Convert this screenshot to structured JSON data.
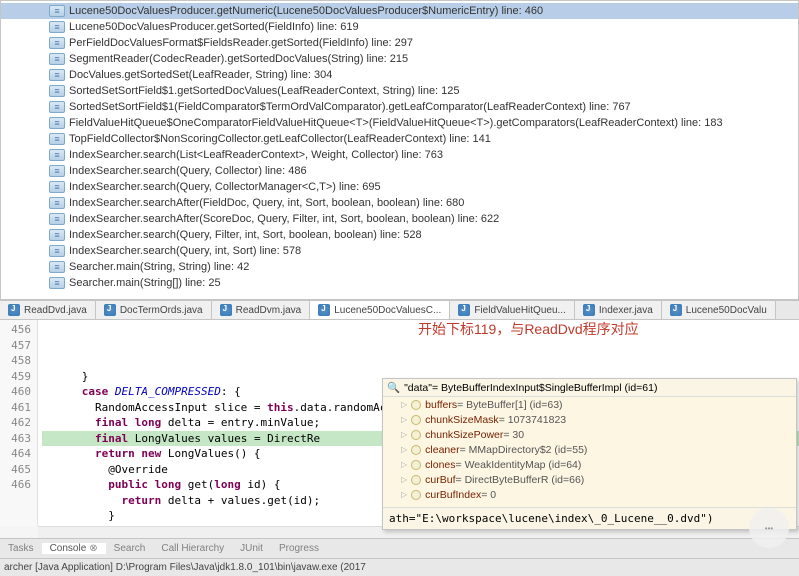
{
  "stack": [
    "Lucene50DocValuesProducer.getNumeric(Lucene50DocValuesProducer$NumericEntry) line: 460",
    "Lucene50DocValuesProducer.getSorted(FieldInfo) line: 619",
    "PerFieldDocValuesFormat$FieldsReader.getSorted(FieldInfo) line: 297",
    "SegmentReader(CodecReader).getSortedDocValues(String) line: 215",
    "DocValues.getSortedSet(LeafReader, String) line: 304",
    "SortedSetSortField$1.getSortedDocValues(LeafReaderContext, String) line: 125",
    "SortedSetSortField$1(FieldComparator$TermOrdValComparator).getLeafComparator(LeafReaderContext) line: 767",
    "FieldValueHitQueue$OneComparatorFieldValueHitQueue<T>(FieldValueHitQueue<T>).getComparators(LeafReaderContext) line: 183",
    "TopFieldCollector$NonScoringCollector.getLeafCollector(LeafReaderContext) line: 141",
    "IndexSearcher.search(List<LeafReaderContext>, Weight, Collector) line: 763",
    "IndexSearcher.search(Query, Collector) line: 486",
    "IndexSearcher.search(Query, CollectorManager<C,T>) line: 695",
    "IndexSearcher.searchAfter(FieldDoc, Query, int, Sort, boolean, boolean) line: 680",
    "IndexSearcher.searchAfter(ScoreDoc, Query, Filter, int, Sort, boolean, boolean) line: 622",
    "IndexSearcher.search(Query, Filter, int, Sort, boolean, boolean) line: 528",
    "IndexSearcher.search(Query, int, Sort) line: 578",
    "Searcher.main(String, String) line: 42",
    "Searcher.main(String[]) line: 25"
  ],
  "stack_selected": 0,
  "tabs": [
    {
      "label": "ReadDvd.java"
    },
    {
      "label": "DocTermOrds.java"
    },
    {
      "label": "ReadDvm.java"
    },
    {
      "label": "Lucene50DocValuesC..."
    },
    {
      "label": "FieldValueHitQueu..."
    },
    {
      "label": "Indexer.java"
    },
    {
      "label": "Lucene50DocValu"
    }
  ],
  "annotation": "开始下标119，与ReadDvd程序对应",
  "code_lines": [
    {
      "n": "456",
      "ind": "      ",
      "text": "}"
    },
    {
      "n": "457",
      "ind": "      ",
      "kw": "case ",
      "const": "DELTA_COMPRESSED",
      "rest": ": {"
    },
    {
      "n": "458",
      "ind": "        ",
      "text2": "RandomAccessInput slice = ",
      "kw2": "this",
      "rest2": ".data.randomAccessSlice(entry.offset, entry.endOffset - "
    },
    {
      "n": "459",
      "ind": "        ",
      "kw": "final long",
      "rest": " delta = entry.minValue;"
    },
    {
      "n": "460",
      "ind": "        ",
      "kw": "final",
      "rest": " LongValues values = DirectRe",
      "hl": true
    },
    {
      "n": "461",
      "ind": "        ",
      "kw": "return new",
      "rest": " LongValues() {"
    },
    {
      "n": "462",
      "ind": "          ",
      "text": "@Override"
    },
    {
      "n": "463",
      "ind": "          ",
      "kw": "public long",
      "rest": " get(",
      "kw2": "long",
      "rest2": " id) {"
    },
    {
      "n": "464",
      "ind": "            ",
      "kw": "return",
      "rest": " delta + values.get(id);"
    },
    {
      "n": "465",
      "ind": "          ",
      "text": "}"
    },
    {
      "n": "466",
      "ind": "        ",
      "text": "};"
    }
  ],
  "inspect": {
    "header": "\"data\"= ByteBufferIndexInput$SingleBufferImpl  (id=61)",
    "vars": [
      {
        "name": "buffers",
        "val": "ByteBuffer[1]  (id=63)"
      },
      {
        "name": "chunkSizeMask",
        "val": "1073741823"
      },
      {
        "name": "chunkSizePower",
        "val": "30"
      },
      {
        "name": "cleaner",
        "val": "MMapDirectory$2  (id=55)"
      },
      {
        "name": "clones",
        "val": "WeakIdentityMap<K,V>  (id=64)"
      },
      {
        "name": "curBuf",
        "val": "DirectByteBufferR  (id=66)"
      },
      {
        "name": "curBufIndex",
        "val": "0"
      }
    ],
    "expr": "ath=\"E:\\workspace\\lucene\\index\\_0_Lucene__0.dvd\")"
  },
  "bottom_tabs": [
    {
      "label": "Tasks"
    },
    {
      "label": "Console",
      "active": true
    },
    {
      "label": "Search"
    },
    {
      "label": "Call Hierarchy"
    },
    {
      "label": "JUnit"
    },
    {
      "label": "Progress"
    }
  ],
  "status": "archer [Java Application] D:\\Program Files\\Java\\jdk1.8.0_101\\bin\\javaw.exe (2017"
}
